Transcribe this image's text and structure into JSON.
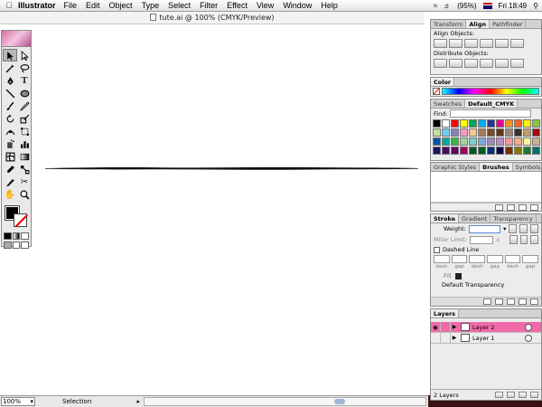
{
  "menubar": {
    "app_name": "Illustrator",
    "items": [
      "File",
      "Edit",
      "Object",
      "Type",
      "Select",
      "Filter",
      "Effect",
      "View",
      "Window",
      "Help"
    ],
    "battery": "(95%)",
    "clock": "Fri 18:49"
  },
  "document": {
    "title": "tute.ai @ 100% (CMYK/Preview)"
  },
  "status": {
    "zoom": "100%",
    "tool": "Selection"
  },
  "panels": {
    "align": {
      "tabs": [
        "Transform",
        "Align",
        "Pathfinder"
      ],
      "align_objects_label": "Align Objects:",
      "distribute_objects_label": "Distribute Objects:"
    },
    "color": {
      "tab": "Color"
    },
    "swatches": {
      "tabs": [
        "Swatches",
        "Default_CMYK"
      ],
      "find_label": "Find:",
      "colors": [
        "#000000",
        "#ffffff",
        "#ff0000",
        "#ffff00",
        "#00a650",
        "#00aeef",
        "#2e3192",
        "#ec008c",
        "#f7941d",
        "#f26522",
        "#fff200",
        "#8dc63f",
        "#c4df9b",
        "#6dcff6",
        "#8781bd",
        "#f49ac2",
        "#fdc689",
        "#a67c52",
        "#754c24",
        "#603913",
        "#998675",
        "#362f2d",
        "#c69c6d",
        "#9e0b0f",
        "#0054a6",
        "#00a99d",
        "#39b54a",
        "#a3d39c",
        "#7accc8",
        "#7da7d9",
        "#a187be",
        "#bd8cbf",
        "#f5989d",
        "#f9ad81",
        "#fff799",
        "#c7b299",
        "#1b1464",
        "#440e62",
        "#630460",
        "#9e005d",
        "#005826",
        "#005e20",
        "#003471",
        "#0d004c",
        "#7b2e00",
        "#827b00",
        "#197b30",
        "#00746b"
      ]
    },
    "brushes": {
      "tabs": [
        "Graphic Styles",
        "Brushes",
        "Symbols"
      ]
    },
    "stroke": {
      "tabs": [
        "Stroke",
        "Gradient",
        "Transparency"
      ],
      "weight_label": "Weight:",
      "miter_label": "Miter Limit:",
      "miter_suffix": "x",
      "dashed_label": "Dashed Line",
      "dash_labels": [
        "dash",
        "gap",
        "dash",
        "gap",
        "dash",
        "gap"
      ],
      "fill_label": "Fill",
      "transparency_label": "Default Transparency"
    },
    "layers": {
      "tab": "Layers",
      "rows": [
        {
          "name": "Layer 2",
          "active": true
        },
        {
          "name": "Layer 1",
          "active": false
        }
      ],
      "footer": "2 Layers"
    }
  },
  "colors": {
    "layer_highlight": "#f06aa9",
    "canvas": "#ffffff",
    "panel_bg": "#ececec"
  }
}
